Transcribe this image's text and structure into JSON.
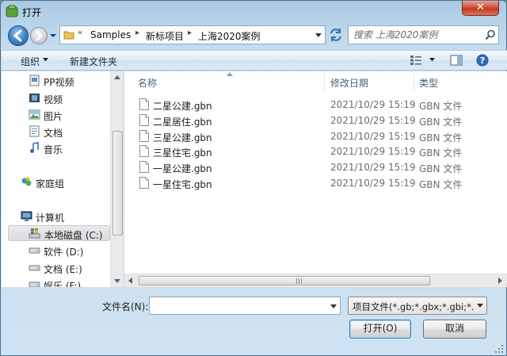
{
  "window": {
    "title": "打开",
    "close_glyph": "✕"
  },
  "navigation": {
    "breadcrumbs": [
      "Samples",
      "新标项目",
      "上海2020案例"
    ],
    "overflow_glyph": "«",
    "separator_glyph": "▸",
    "search_placeholder": "搜索 上海2020案例"
  },
  "toolbar": {
    "organize_label": "组织",
    "new_folder_label": "新建文件夹"
  },
  "sidebar": {
    "items": [
      {
        "label": "PP视频",
        "icon": "video-library-icon"
      },
      {
        "label": "视频",
        "icon": "film-icon"
      },
      {
        "label": "图片",
        "icon": "picture-icon"
      },
      {
        "label": "文档",
        "icon": "document-icon"
      },
      {
        "label": "音乐",
        "icon": "music-note-icon"
      },
      {
        "label": "家庭组",
        "icon": "homegroup-icon"
      },
      {
        "label": "计算机",
        "icon": "computer-icon"
      },
      {
        "label": "本地磁盘 (C:)",
        "icon": "windows-drive-icon"
      },
      {
        "label": "软件 (D:)",
        "icon": "drive-icon"
      },
      {
        "label": "文档 (E:)",
        "icon": "drive-icon"
      },
      {
        "label": "娱乐 (F:)",
        "icon": "drive-icon"
      }
    ]
  },
  "file_list": {
    "columns": {
      "name": "名称",
      "date": "修改日期",
      "type": "类型"
    },
    "rows": [
      {
        "name": "二星公建.gbn",
        "date": "2021/10/29 15:19",
        "type": "GBN 文件"
      },
      {
        "name": "二星居住.gbn",
        "date": "2021/10/29 15:19",
        "type": "GBN 文件"
      },
      {
        "name": "三星公建.gbn",
        "date": "2021/10/29 15:19",
        "type": "GBN 文件"
      },
      {
        "name": "三星住宅.gbn",
        "date": "2021/10/29 15:19",
        "type": "GBN 文件"
      },
      {
        "name": "一星公建.gbn",
        "date": "2021/10/29 15:19",
        "type": "GBN 文件"
      },
      {
        "name": "一星住宅.gbn",
        "date": "2021/10/29 15:19",
        "type": "GBN 文件"
      }
    ]
  },
  "footer": {
    "filename_label": "文件名(N):",
    "filename_value": "",
    "filetype_value": "项目文件(*.gb;*.gbx;*.gbi;*.gb",
    "open_label": "打开(O)",
    "cancel_label": "取消"
  },
  "colors": {
    "accent": "#3c7fb1",
    "close_red": "#c13a22",
    "folder_yellow": "#e8c35a"
  }
}
